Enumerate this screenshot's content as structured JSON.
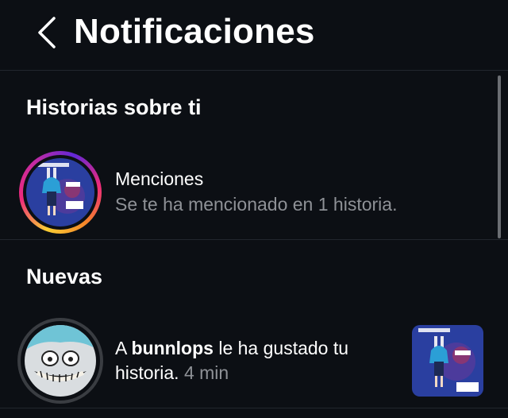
{
  "header": {
    "title": "Notificaciones",
    "back_icon": "chevron-left-icon"
  },
  "sections": {
    "stories_about_you": {
      "title": "Historias sobre ti",
      "row": {
        "title": "Menciones",
        "subtitle": "Se te ha mencionado en 1 historia."
      }
    },
    "new": {
      "title": "Nuevas",
      "notification": {
        "prefix": "A ",
        "username": "bunnlops",
        "action": " le ha gustado tu historia.",
        "time": "4 min"
      }
    }
  },
  "colors": {
    "background": "#0c0f14",
    "secondary_text": "#8e9196",
    "divider": "#22262d",
    "story_ring_start": "#f9ce34",
    "story_ring_mid": "#ee2a7b",
    "story_ring_end": "#6228d7"
  }
}
